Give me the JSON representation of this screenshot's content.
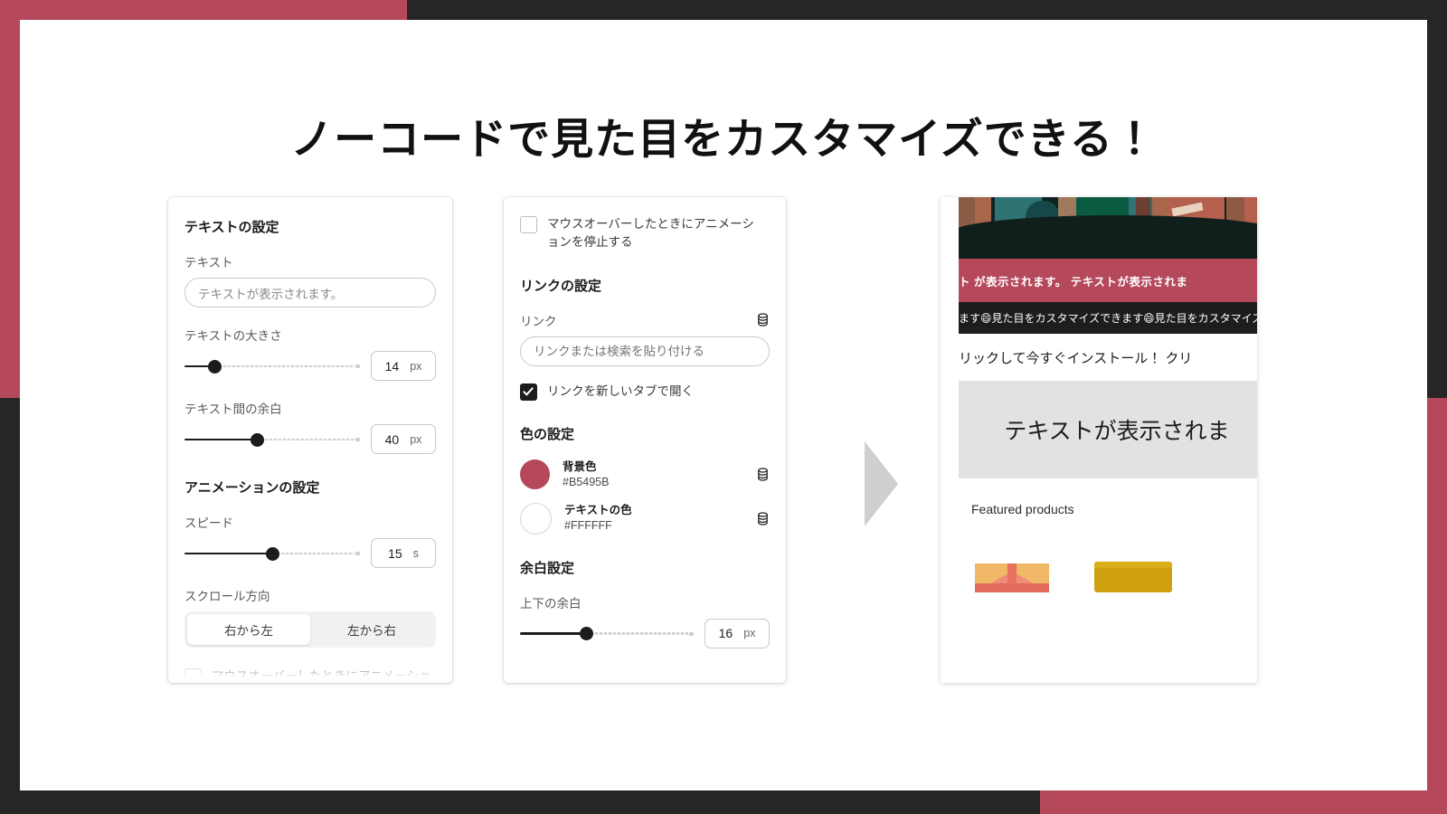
{
  "title": "ノーコードで見た目をカスタマイズできる！",
  "theme": {
    "crimson": "#B5495B",
    "dark": "#262626",
    "arrow": "#CFCFCF"
  },
  "panel_text": {
    "section_title": "テキストの設定",
    "text_field": {
      "label": "テキスト",
      "value": "テキストが表示されます。"
    },
    "font_size": {
      "label": "テキストの大きさ",
      "value": "14",
      "unit": "px",
      "percent": 17
    },
    "text_gap": {
      "label": "テキスト間の余白",
      "value": "40",
      "unit": "px",
      "percent": 41
    },
    "animation_title": "アニメーションの設定",
    "speed": {
      "label": "スピード",
      "value": "15",
      "unit": "s",
      "percent": 50
    },
    "scroll_direction": {
      "label": "スクロール方向",
      "options": [
        "右から左",
        "左から右"
      ],
      "selected": "右から左"
    },
    "pause_on_hover": {
      "label": "マウスオーバーしたときにアニメーショ",
      "checked": false
    }
  },
  "panel_link": {
    "pause_on_hover": {
      "label": "マウスオーバーしたときにアニメーションを停止する",
      "checked": false
    },
    "link_section_title": "リンクの設定",
    "link_field": {
      "label": "リンク",
      "value": "",
      "placeholder": "リンクまたは検索を貼り付ける",
      "icon": "database-icon"
    },
    "open_new_tab": {
      "label": "リンクを新しいタブで開く",
      "checked": true
    },
    "color_section_title": "色の設定",
    "colors": [
      {
        "name": "背景色",
        "hex": "#B5495B",
        "icon": "database-icon"
      },
      {
        "name": "テキストの色",
        "hex": "#FFFFFF",
        "icon": "database-icon"
      }
    ],
    "spacing_section_title": "余白設定",
    "vertical_padding": {
      "label": "上下の余白",
      "value": "16",
      "unit": "px",
      "percent": 38
    }
  },
  "preview": {
    "marquee_crimson": "ト が表示されます。 テキストが表示されま",
    "marquee_dark": "ます😄見た目をカスタマイズできます😄見た目をカスタマイズでき",
    "cta": "リックして今すぐインストール！ クリ",
    "big_text": "テキストが表示されま",
    "featured_label": "Featured products",
    "products": [
      "gift-box",
      "soap-bar"
    ]
  },
  "arrow": {
    "name": "next-step-arrow"
  }
}
